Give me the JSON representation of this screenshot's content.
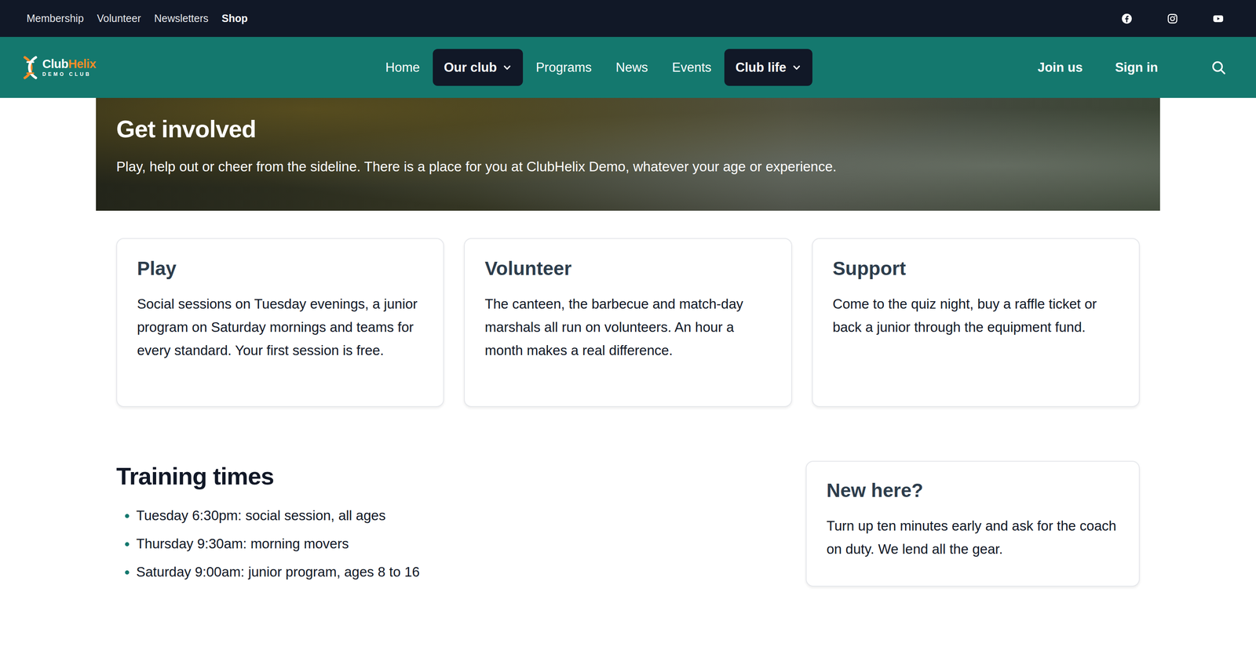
{
  "topbar": {
    "links": [
      {
        "label": "Membership",
        "selected": false
      },
      {
        "label": "Volunteer",
        "selected": false
      },
      {
        "label": "Newsletters",
        "selected": false
      },
      {
        "label": "Shop",
        "selected": true
      }
    ]
  },
  "logo": {
    "name_first": "Club",
    "name_second": "Helix",
    "tagline": "DEMO CLUB"
  },
  "nav": {
    "items": [
      {
        "label": "Home",
        "selected": false,
        "has_menu": false
      },
      {
        "label": "Our club",
        "selected": true,
        "has_menu": true
      },
      {
        "label": "Programs",
        "selected": false,
        "has_menu": false
      },
      {
        "label": "News",
        "selected": false,
        "has_menu": false
      },
      {
        "label": "Events",
        "selected": false,
        "has_menu": false
      },
      {
        "label": "Club life",
        "selected": true,
        "has_menu": true
      }
    ]
  },
  "actions": [
    "Join us",
    "Sign in"
  ],
  "hero": {
    "title": "Get involved",
    "text": "Play, help out or cheer from the sideline. There is a place for you at ClubHelix Demo, whatever your age or experience."
  },
  "cards": [
    {
      "title": "Play",
      "text": "Social sessions on Tuesday evenings, a junior program on Saturday mornings and teams for every standard. Your first session is free."
    },
    {
      "title": "Volunteer",
      "text": "The canteen, the barbecue and match-day marshals all run on volunteers. An hour a month makes a real difference."
    },
    {
      "title": "Support",
      "text": "Come to the quiz night, buy a raffle ticket or back a junior through the equipment fund."
    }
  ],
  "training": {
    "title": "Training times",
    "items": [
      "Tuesday 6:30pm: social session, all ages",
      "Thursday 9:30am: morning movers",
      "Saturday 9:00am: junior program, ages 8 to 16"
    ]
  },
  "aside": {
    "title": "New here?",
    "text": "Turn up ten minutes early and ask for the coach on duty. We lend all the gear."
  }
}
